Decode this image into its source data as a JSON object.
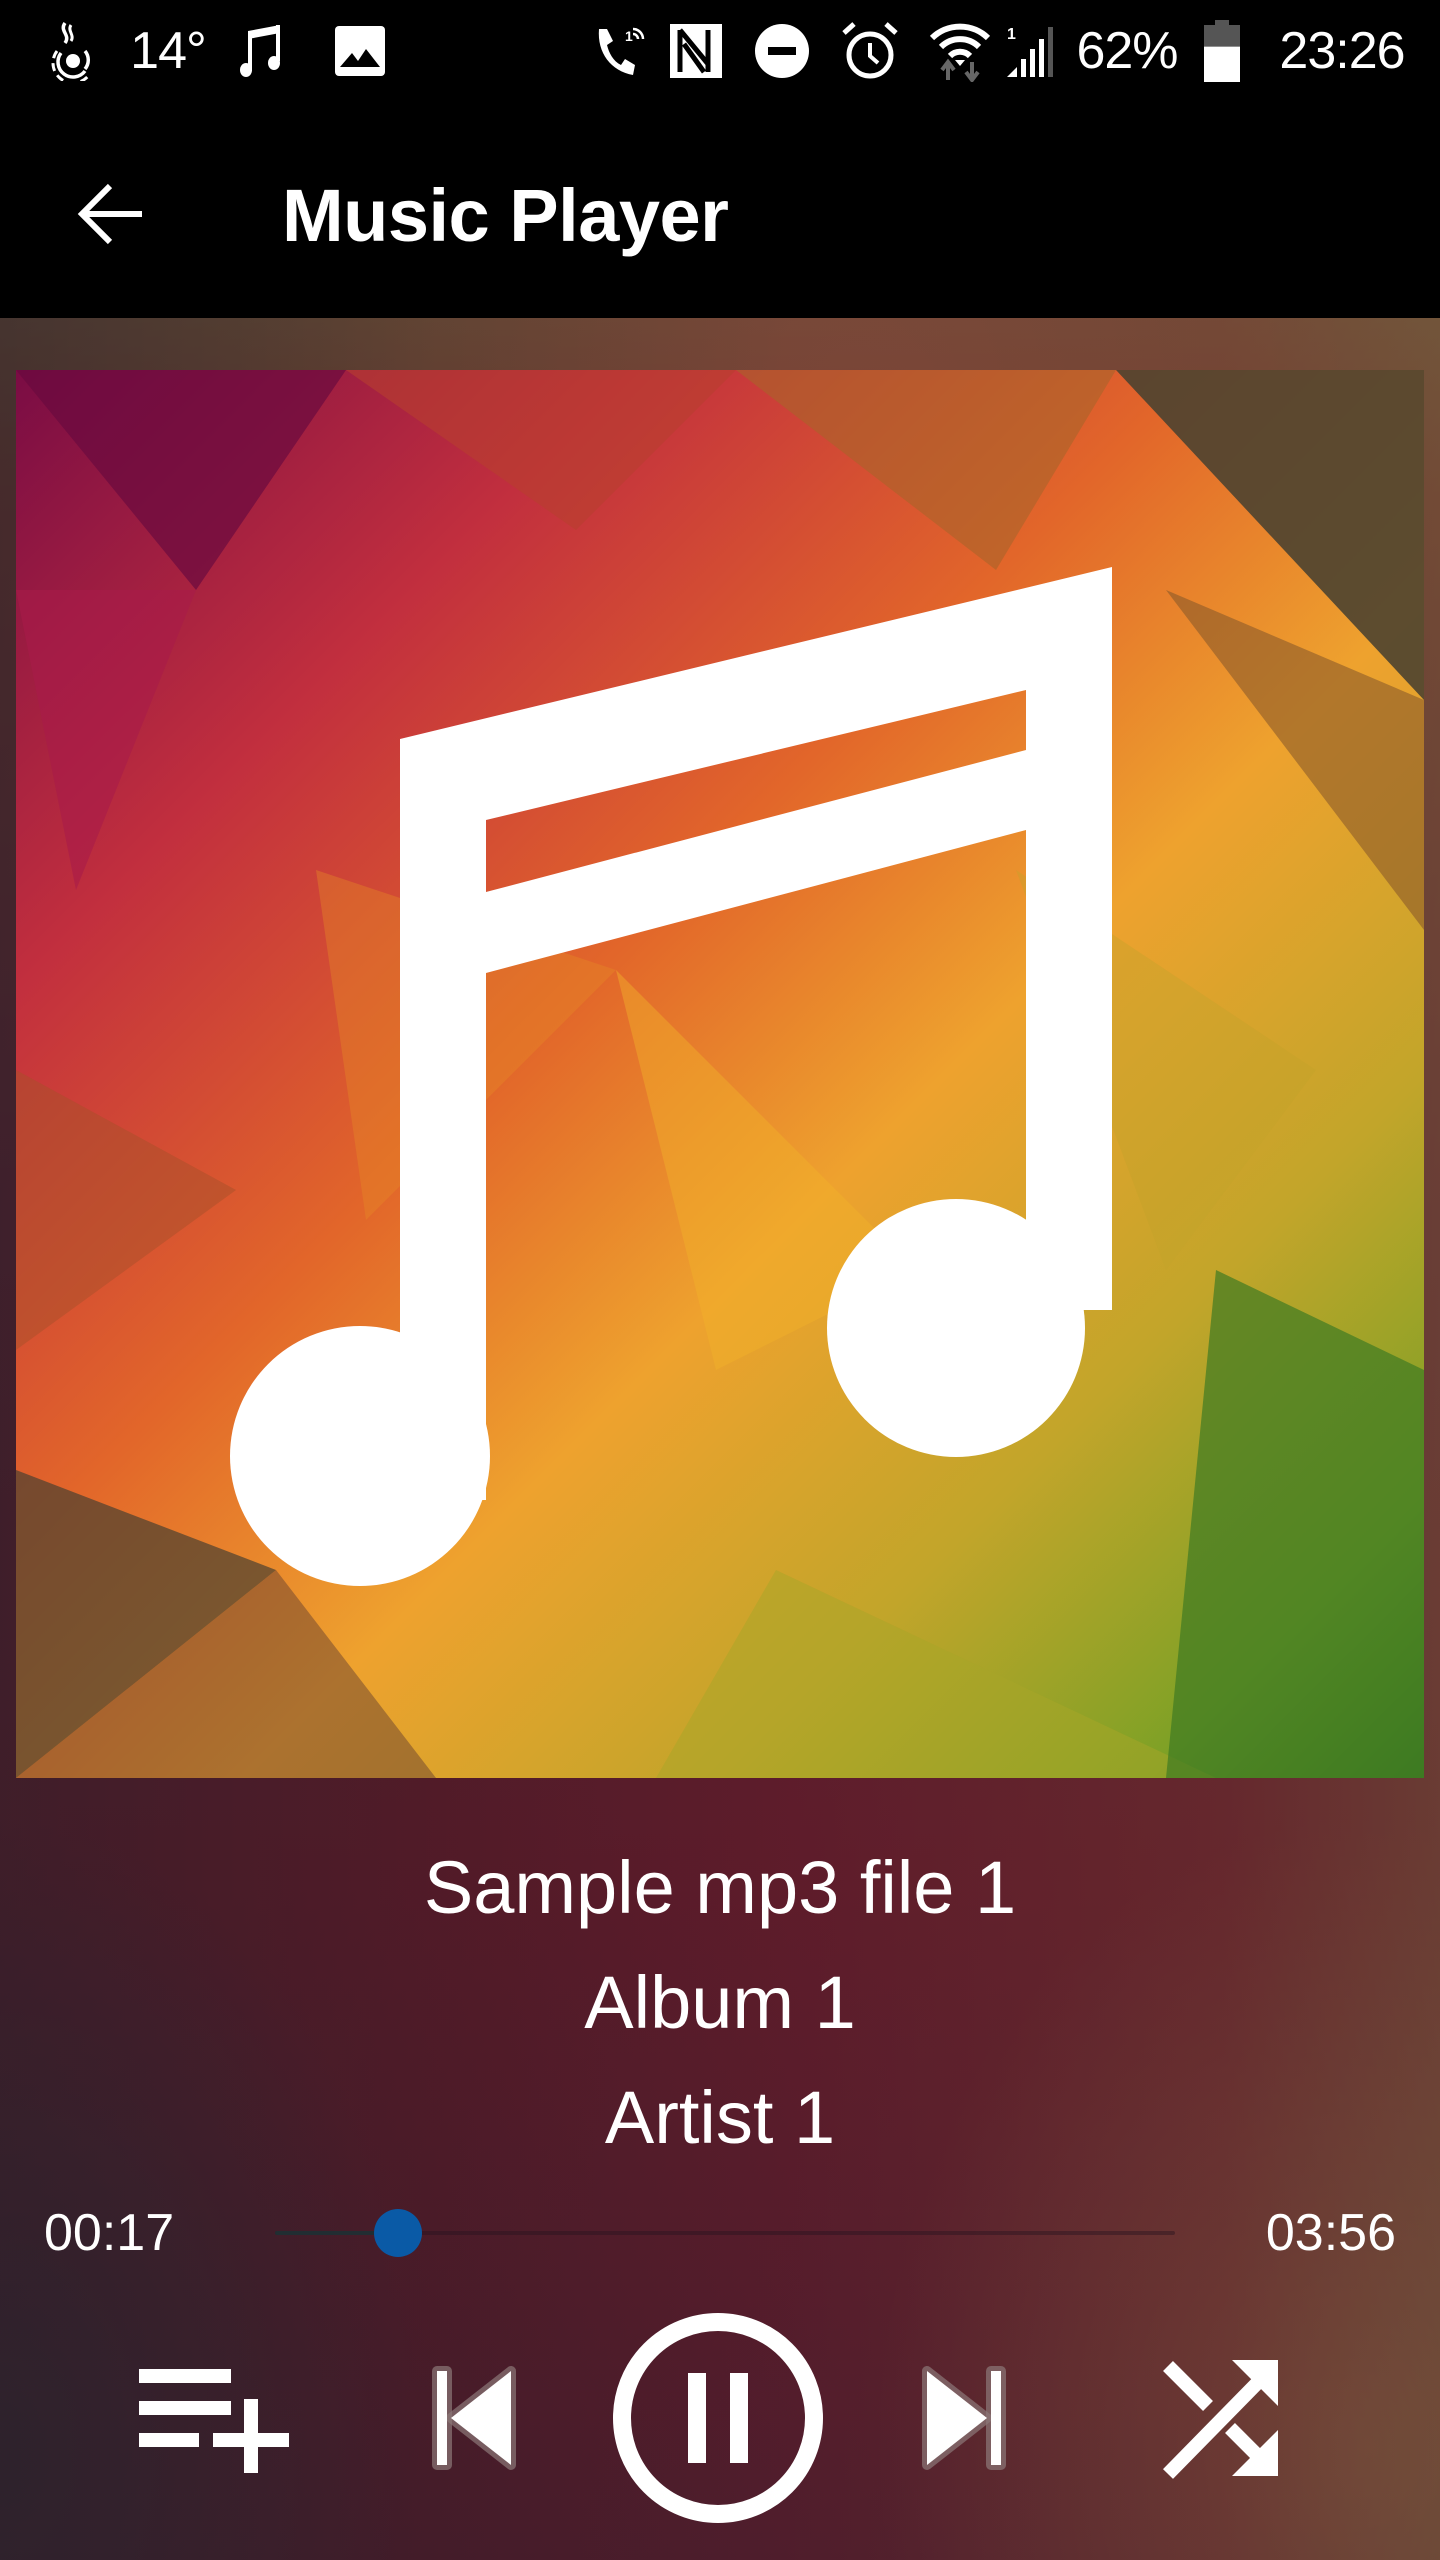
{
  "status_bar": {
    "left_icons": [
      "weather-app-icon",
      "music-notification-icon",
      "gallery-image-icon"
    ],
    "temperature": "14°",
    "right_icons": [
      "hd-voice-call-icon",
      "nfc-icon",
      "do-not-disturb-icon",
      "alarm-clock-icon",
      "wifi-data-icon",
      "cellular-signal-icon",
      "battery-icon"
    ],
    "sim_slot": "1",
    "battery_percent": "62%",
    "battery_level": 0.62,
    "time": "23:26"
  },
  "app_bar": {
    "back_icon": "arrow-left-icon",
    "title": "Music Player"
  },
  "player": {
    "album_art_icon": "music-note-icon",
    "song_title": "Sample mp3 file 1",
    "album": "Album 1",
    "artist": "Artist 1",
    "current_time": "00:17",
    "total_time": "03:56",
    "progress_fraction": 0.072,
    "accent_color": "#0a5aa6",
    "controls": [
      {
        "name": "add-to-playlist",
        "icon": "playlist-add-icon"
      },
      {
        "name": "previous",
        "icon": "skip-previous-icon"
      },
      {
        "name": "pause",
        "icon": "pause-circle-icon"
      },
      {
        "name": "next",
        "icon": "skip-next-icon"
      },
      {
        "name": "shuffle",
        "icon": "shuffle-icon"
      }
    ]
  }
}
